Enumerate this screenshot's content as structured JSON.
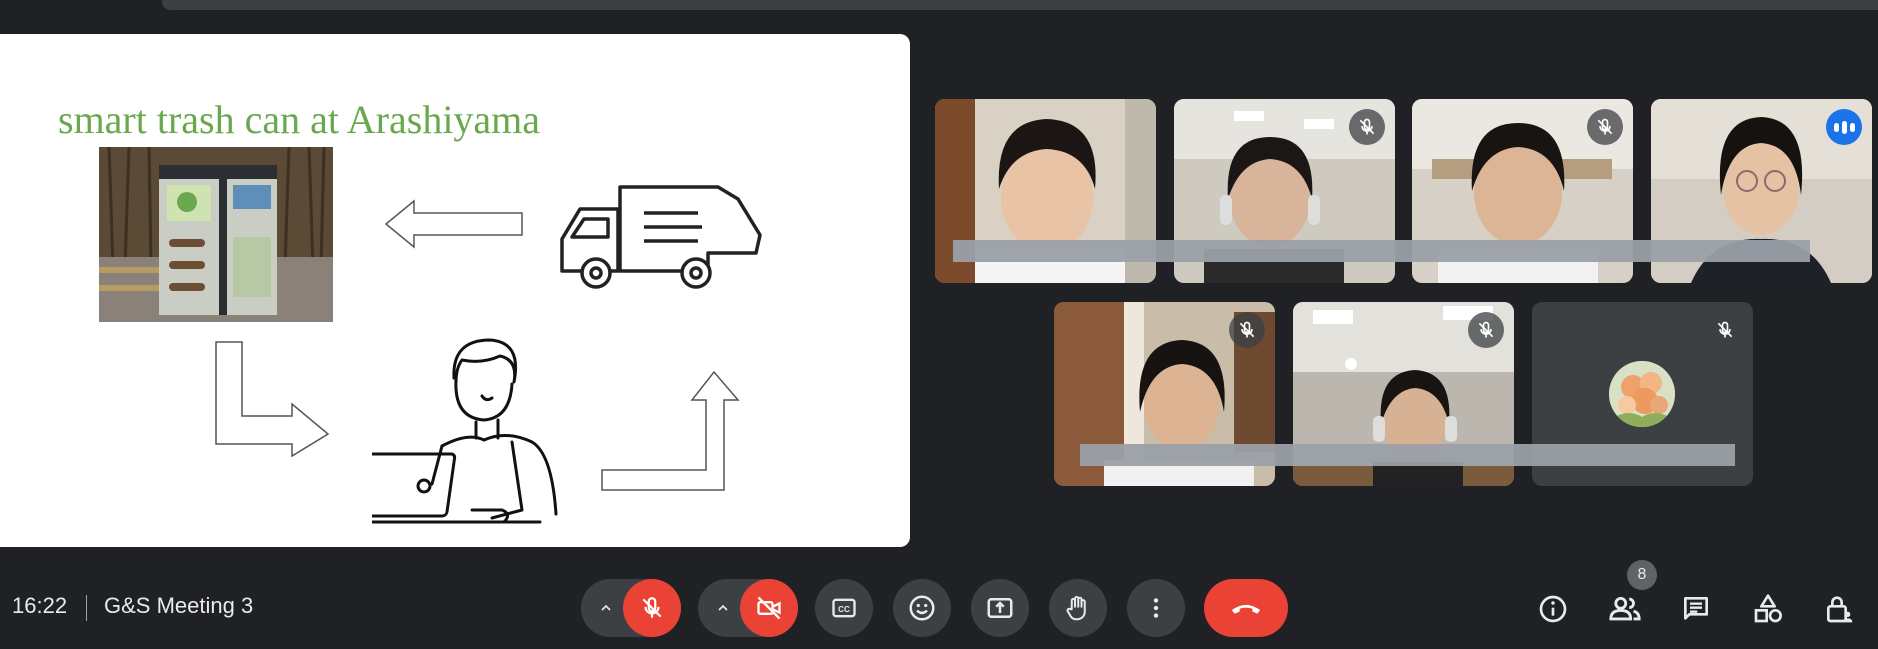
{
  "slide": {
    "title": "smart trash can at Arashiyama"
  },
  "participants": [
    {
      "label": "participant-1",
      "muted": false,
      "speaking": false
    },
    {
      "label": "participant-2",
      "muted": true,
      "speaking": false
    },
    {
      "label": "participant-3",
      "muted": true,
      "speaking": false
    },
    {
      "label": "participant-4",
      "muted": false,
      "speaking": true
    },
    {
      "label": "participant-5",
      "muted": true,
      "speaking": false
    },
    {
      "label": "participant-6",
      "muted": true,
      "speaking": false
    },
    {
      "label": "participant-7",
      "muted": true,
      "speaking": false
    }
  ],
  "bottom_bar": {
    "time": "16:22",
    "meeting_title": "G&S Meeting 3",
    "participant_count": "8"
  },
  "icons": {
    "mic": "mic-off-icon",
    "camera": "camera-off-icon",
    "captions": "captions-icon",
    "reactions": "emoji-icon",
    "present": "present-screen-icon",
    "raise_hand": "hand-icon",
    "more": "more-vert-icon",
    "hangup": "phone-hangup-icon",
    "info": "info-icon",
    "people": "people-icon",
    "chat": "chat-icon",
    "activities": "activities-icon",
    "host_controls": "lock-person-icon"
  },
  "colors": {
    "background": "#202124",
    "surface": "#3c4043",
    "danger": "#ea4335",
    "accent": "#1a73e8",
    "slide_title": "#6aa84f"
  }
}
